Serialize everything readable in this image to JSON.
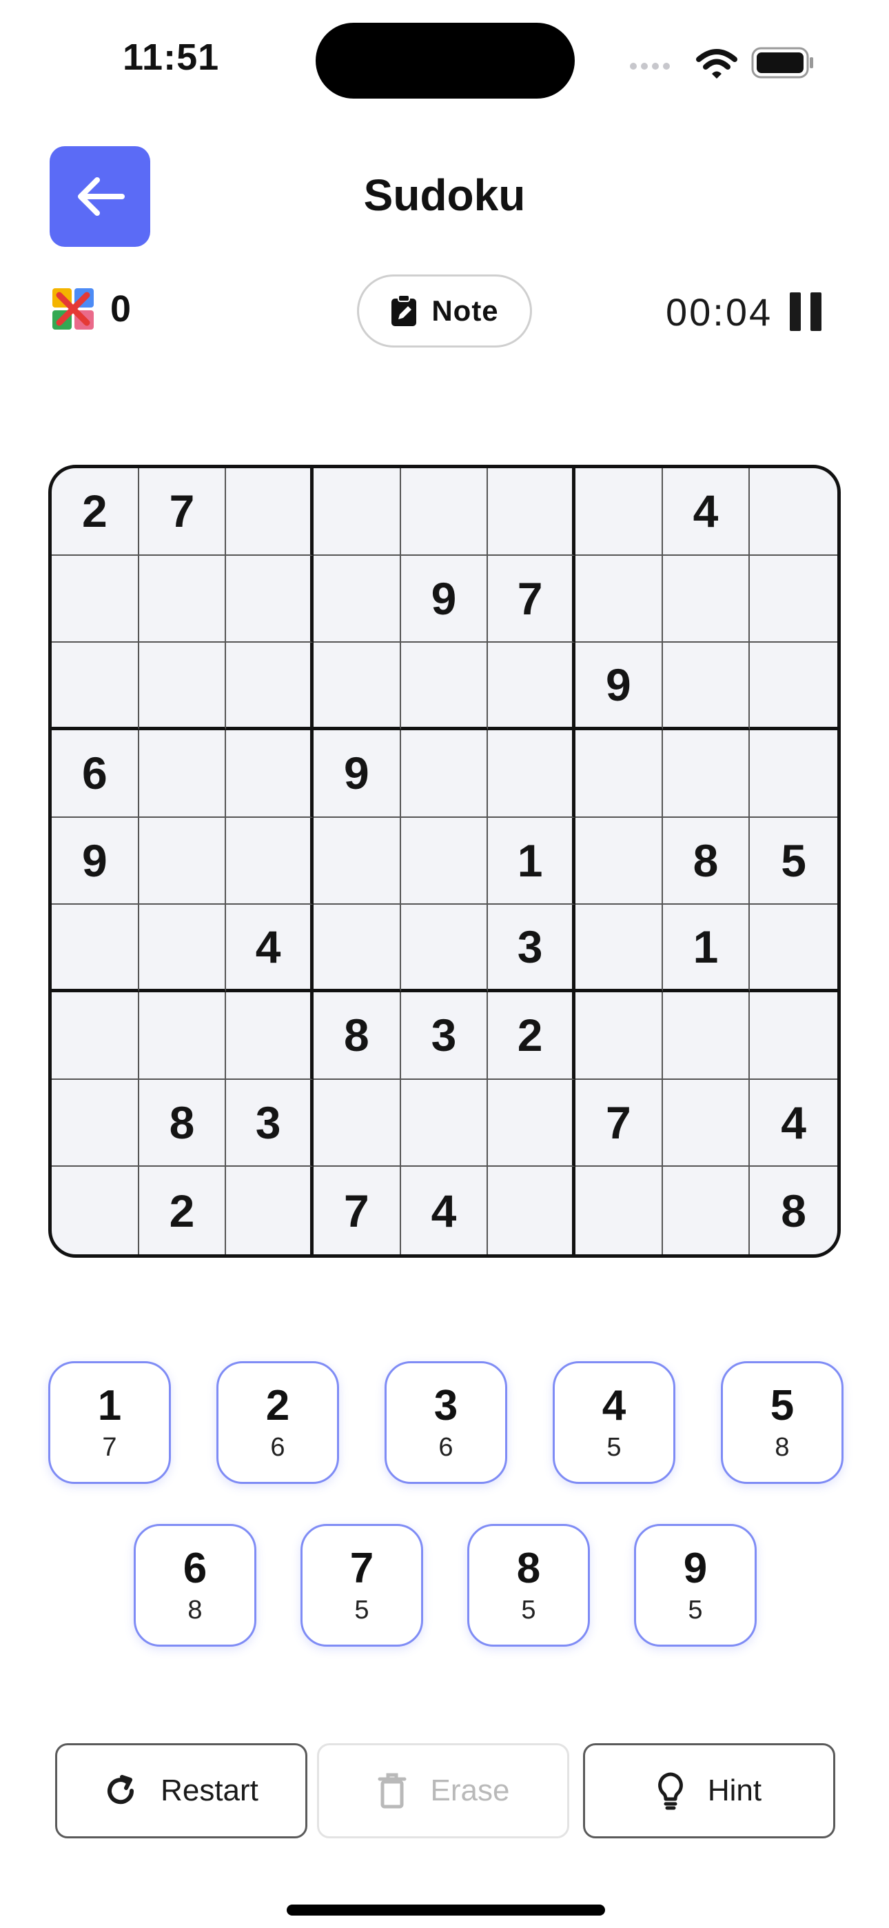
{
  "status_bar": {
    "time": "11:51"
  },
  "header": {
    "title": "Sudoku"
  },
  "info": {
    "mistakes": "0",
    "note_label": "Note",
    "timer": "00:04"
  },
  "board": [
    [
      "2",
      "7",
      "",
      "",
      "",
      "",
      "",
      "4",
      ""
    ],
    [
      "",
      "",
      "",
      "",
      "9",
      "7",
      "",
      "",
      ""
    ],
    [
      "",
      "",
      "",
      "",
      "",
      "",
      "9",
      "",
      ""
    ],
    [
      "6",
      "",
      "",
      "9",
      "",
      "",
      "",
      "",
      ""
    ],
    [
      "9",
      "",
      "",
      "",
      "",
      "1",
      "",
      "8",
      "5"
    ],
    [
      "",
      "",
      "4",
      "",
      "",
      "3",
      "",
      "1",
      ""
    ],
    [
      "",
      "",
      "",
      "8",
      "3",
      "2",
      "",
      "",
      ""
    ],
    [
      "",
      "8",
      "3",
      "",
      "",
      "",
      "7",
      "",
      "4"
    ],
    [
      "",
      "2",
      "",
      "7",
      "4",
      "",
      "",
      "",
      "8"
    ]
  ],
  "numpad": [
    {
      "digit": "1",
      "remaining": "7"
    },
    {
      "digit": "2",
      "remaining": "6"
    },
    {
      "digit": "3",
      "remaining": "6"
    },
    {
      "digit": "4",
      "remaining": "5"
    },
    {
      "digit": "5",
      "remaining": "8"
    },
    {
      "digit": "6",
      "remaining": "8"
    },
    {
      "digit": "7",
      "remaining": "5"
    },
    {
      "digit": "8",
      "remaining": "5"
    },
    {
      "digit": "9",
      "remaining": "5"
    }
  ],
  "actions": {
    "restart": "Restart",
    "erase": "Erase",
    "hint": "Hint"
  },
  "colors": {
    "accent": "#5b6bf6",
    "board_bg": "#f3f4f8",
    "disabled_text": "#b9b9b9"
  }
}
